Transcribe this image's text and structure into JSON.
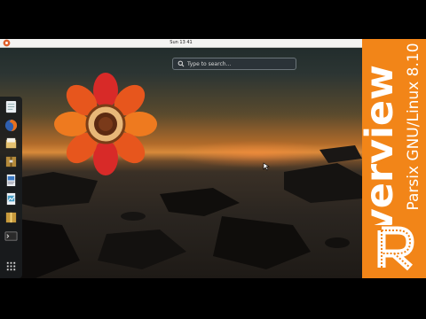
{
  "topbar": {
    "clock": "Sun 13 41"
  },
  "search": {
    "placeholder": "Type to search..."
  },
  "dash": {
    "items": [
      "text-editor-icon",
      "firefox-icon",
      "file-manager-icon",
      "archive-icon",
      "document-icon",
      "spreadsheet-icon",
      "package-icon",
      "terminal-icon",
      "app-grid-icon"
    ]
  },
  "overlay": {
    "distro": "Parsix GNU/Linux 8.10",
    "title": "overview",
    "logo_letter": "R"
  },
  "colors": {
    "overlay_orange": "#f28518",
    "panel": "#f3f3f1",
    "dash": "#1c1f21"
  }
}
